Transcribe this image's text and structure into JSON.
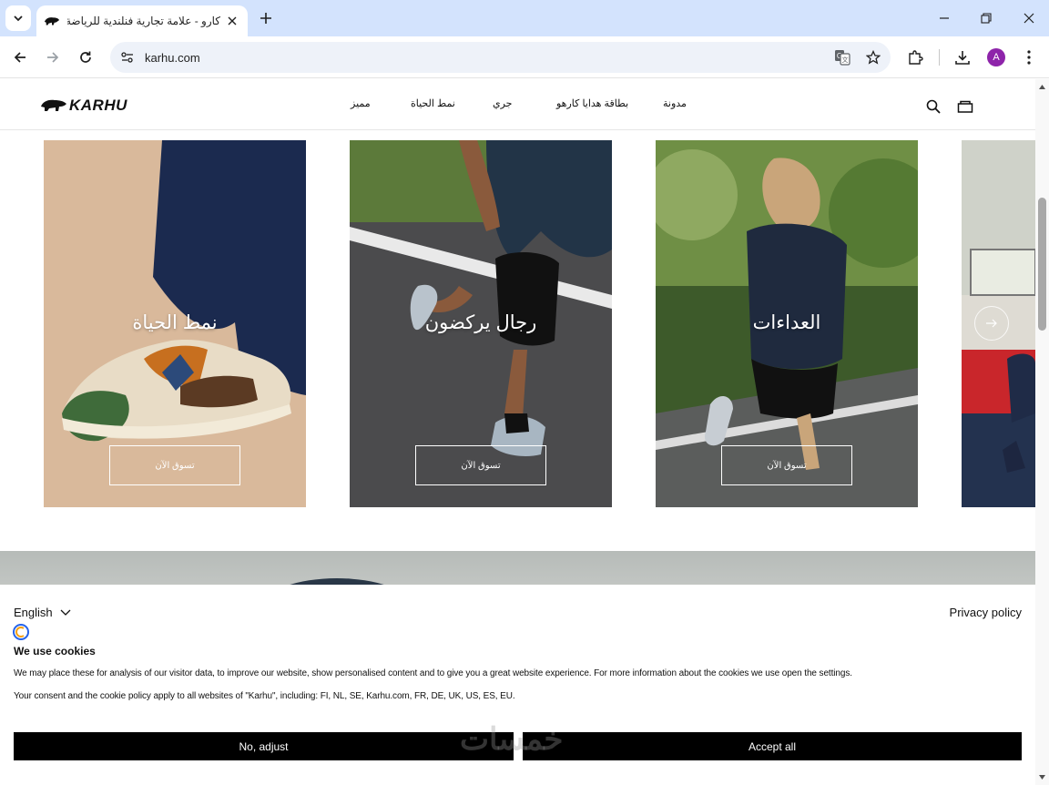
{
  "browser": {
    "tab_title": "كارو - علامة تجارية فنلندية للرياضة",
    "url": "karhu.com",
    "profile_initial": "A",
    "new_tab_label": "+"
  },
  "site": {
    "logo_text": "KARHU",
    "nav": [
      "مميز",
      "نمط الحياة",
      "جري",
      "بطاقة هدايا كارهو",
      "مدونة"
    ]
  },
  "cards": [
    {
      "title": "نمط الحياة",
      "button": "تسوق الآن"
    },
    {
      "title": "رجال يركضون",
      "button": "تسوق الآن"
    },
    {
      "title": "العداءات",
      "button": "تسوق الآن"
    }
  ],
  "cookie_banner": {
    "language": "English",
    "privacy_link": "Privacy policy",
    "title": "We use cookies",
    "body_1": "We may place these for analysis of our visitor data, to improve our website, show personalised content and to give you a great website experience. For more information about the cookies we use open the settings.",
    "body_2": "Your consent and the cookie policy apply to all websites of \"Karhu\", including: FI, NL, SE, Karhu.com, FR, DE, UK, US, ES, EU.",
    "adjust_button": "No, adjust",
    "accept_button": "Accept all"
  },
  "watermark": "خمسات",
  "colors": {
    "tabstrip": "#d3e3fd",
    "omnibox": "#eef2f9",
    "avatar": "#8e24aa",
    "button_bg": "#000000"
  }
}
